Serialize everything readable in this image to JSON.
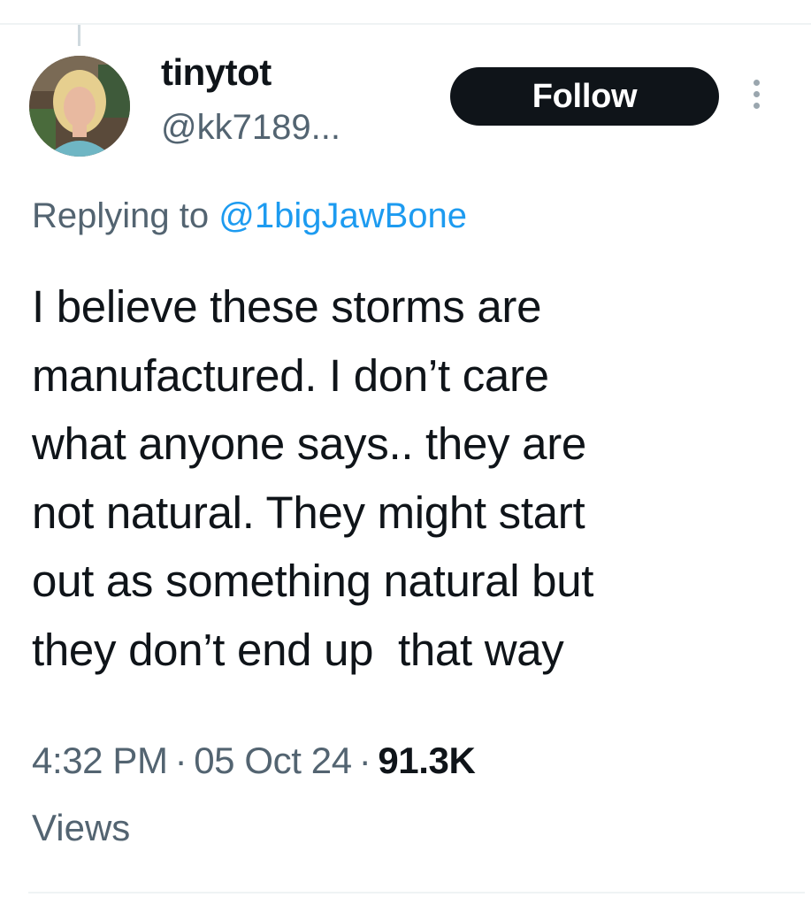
{
  "tweet": {
    "display_name": "tinytot",
    "handle": "@kk7189...",
    "follow_label": "Follow",
    "replying_prefix": "Replying to",
    "replying_to": "@1bigJawBone",
    "text_lines": [
      "I believe these storms are",
      "manufactured. I don’t care",
      "what anyone says.. they are",
      "not natural. They might start",
      "out as something natural but",
      "they don’t end up  that way"
    ],
    "time": "4:32 PM",
    "date": "05 Oct 24",
    "separator": "·",
    "views_count": "91.3K",
    "views_label": "Views"
  },
  "icons": {
    "avatar": "user-avatar-photo",
    "more": "more-options-icon"
  },
  "colors": {
    "primary_text": "#0f1419",
    "secondary_text": "#536471",
    "link": "#1d9bf0",
    "follow_button_bg": "#0f1419",
    "follow_button_text": "#ffffff"
  }
}
